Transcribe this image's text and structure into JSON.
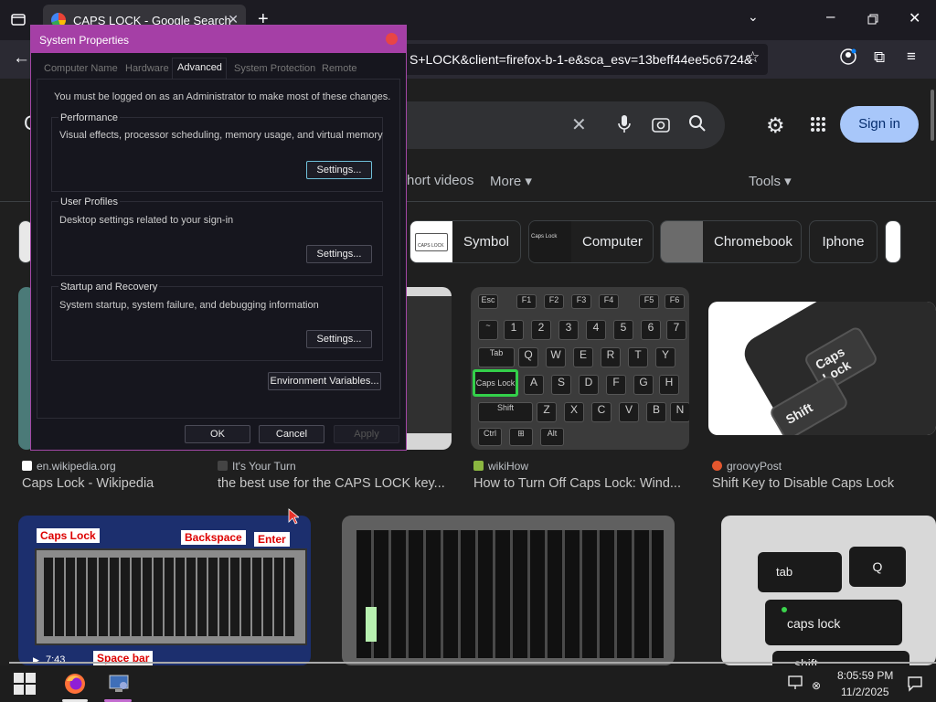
{
  "browser": {
    "tab_title": "CAPS LOCK - Google Search",
    "url": "S+LOCK&client=firefox-b-1-e&sca_esv=13beff44ee5c6724&"
  },
  "google": {
    "signin_label": "Sign in",
    "filters": [
      "hort videos",
      "More ▾",
      "Tools ▾"
    ],
    "chips": [
      "Symbol",
      "Computer",
      "Chromebook",
      "Iphone"
    ],
    "results": [
      {
        "source": "en.wikipedia.org",
        "title": "Caps Lock - Wikipedia"
      },
      {
        "source": "It's Your Turn",
        "title": "the best use for the CAPS LOCK key..."
      },
      {
        "source": "wikiHow",
        "title": "How to Turn Off Caps Lock: Wind..."
      },
      {
        "source": "groovyPost",
        "title": "Shift Key to Disable Caps Lock"
      }
    ],
    "image_labels": {
      "caps_lock": "Caps Lock",
      "backspace": "Backspace",
      "enter": "Enter",
      "space_bar": "Space bar",
      "caps_key_text": "Caps\nLock",
      "shift": "Shift",
      "tab": "tab",
      "caps_lock_lower": "caps lock",
      "shift_lower": "shift",
      "q": "Q"
    },
    "video_time": "7:43"
  },
  "dialog": {
    "title": "System Properties",
    "tabs": [
      "Computer Name",
      "Hardware",
      "Advanced",
      "System Protection",
      "Remote"
    ],
    "admin_note": "You must be logged on as an Administrator to make most of these changes.",
    "groups": [
      {
        "label": "Performance",
        "desc": "Visual effects, processor scheduling, memory usage, and virtual memory",
        "button": "Settings..."
      },
      {
        "label": "User Profiles",
        "desc": "Desktop settings related to your sign-in",
        "button": "Settings..."
      },
      {
        "label": "Startup and Recovery",
        "desc": "System startup, system failure, and debugging information",
        "button": "Settings..."
      }
    ],
    "env_button": "Environment Variables...",
    "ok": "OK",
    "cancel": "Cancel",
    "apply": "Apply"
  },
  "taskbar": {
    "time": "8:05:59 PM",
    "date": "11/2/2025"
  }
}
